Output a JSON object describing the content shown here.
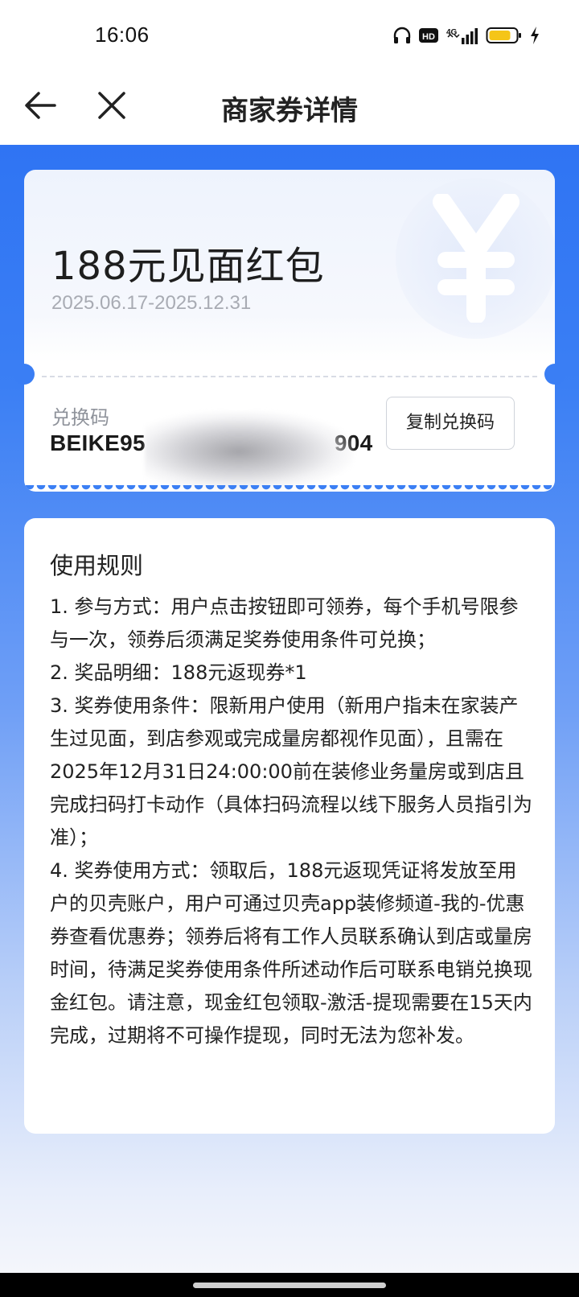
{
  "status_bar": {
    "time": "16:06",
    "icons": [
      "headphones-icon",
      "hd-icon",
      "4g-signal-icon",
      "battery-icon",
      "charging-icon"
    ],
    "network_label": "4G",
    "hd_label": "HD"
  },
  "nav": {
    "title": "商家券详情",
    "back_icon": "arrow-left-icon",
    "close_icon": "close-icon"
  },
  "coupon": {
    "title": "188元见面红包",
    "validity": "2025.06.17-2025.12.31",
    "code_label": "兑换码",
    "code_value_start": "BEIKE95",
    "code_value_end": "904",
    "copy_button_label": "复制兑换码",
    "deco_icon": "yen-icon"
  },
  "rules": {
    "title": "使用规则",
    "items": [
      "1. 参与方式：用户点击按钮即可领券，每个手机号限参与一次，领券后须满足奖券使用条件可兑换；",
      "2. 奖品明细：188元返现券*1",
      "3. 奖券使用条件：限新用户使用（新用户指未在家装产生过见面，到店参观或完成量房都视作见面），且需在2025年12月31日24:00:00前在装修业务量房或到店且完成扫码打卡动作（具体扫码流程以线下服务人员指引为准）；",
      "4. 奖券使用方式：领取后，188元返现凭证将发放至用户的贝壳账户，用户可通过贝壳app装修频道-我的-优惠券查看优惠券；领券后将有工作人员联系确认到店或量房时间，待满足奖券使用条件所述动作后可联系电销兑换现金红包。请注意，现金红包领取-激活-提现需要在15天内完成，过期将不可操作提现，同时无法为您补发。"
    ]
  },
  "colors": {
    "brand_blue": "#2f74f3",
    "battery_yellow": "#f5c518",
    "text_primary": "#222222",
    "text_secondary": "#a8abb3"
  }
}
